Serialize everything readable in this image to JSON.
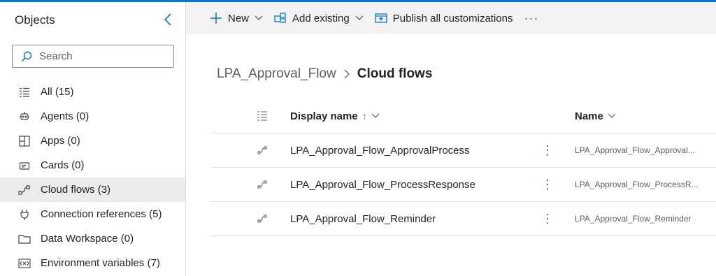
{
  "sidebar": {
    "title": "Objects",
    "search_placeholder": "Search",
    "items": [
      {
        "label": "All",
        "count": "(15)",
        "icon": "list-icon"
      },
      {
        "label": "Agents",
        "count": "(0)",
        "icon": "agent-icon"
      },
      {
        "label": "Apps",
        "count": "(0)",
        "icon": "apps-icon"
      },
      {
        "label": "Cards",
        "count": "(0)",
        "icon": "card-icon"
      },
      {
        "label": "Cloud flows",
        "count": "(3)",
        "icon": "flow-icon"
      },
      {
        "label": "Connection references",
        "count": "(5)",
        "icon": "plug-icon"
      },
      {
        "label": "Data Workspace",
        "count": "(0)",
        "icon": "folder-icon"
      },
      {
        "label": "Environment variables",
        "count": "(7)",
        "icon": "variable-icon"
      }
    ],
    "selected": "Cloud flows"
  },
  "toolbar": {
    "new_label": "New",
    "add_existing_label": "Add existing",
    "publish_label": "Publish all customizations",
    "more_label": "···"
  },
  "breadcrumb": {
    "parent": "LPA_Approval_Flow",
    "current": "Cloud flows"
  },
  "table": {
    "headers": {
      "display_name": "Display name",
      "sort_indicator": "↑",
      "name": "Name"
    },
    "rows": [
      {
        "display_name": "LPA_Approval_Flow_ApprovalProcess",
        "name": "LPA_Approval_Flow_Approval..."
      },
      {
        "display_name": "LPA_Approval_Flow_ProcessResponse",
        "name": "LPA_Approval_Flow_ProcessR..."
      },
      {
        "display_name": "LPA_Approval_Flow_Reminder",
        "name": "LPA_Approval_Flow_Reminder"
      }
    ]
  },
  "colors": {
    "accent": "#0078d4",
    "selected_bg": "#edebe9",
    "toolbar_bg": "#f3f2f1"
  }
}
